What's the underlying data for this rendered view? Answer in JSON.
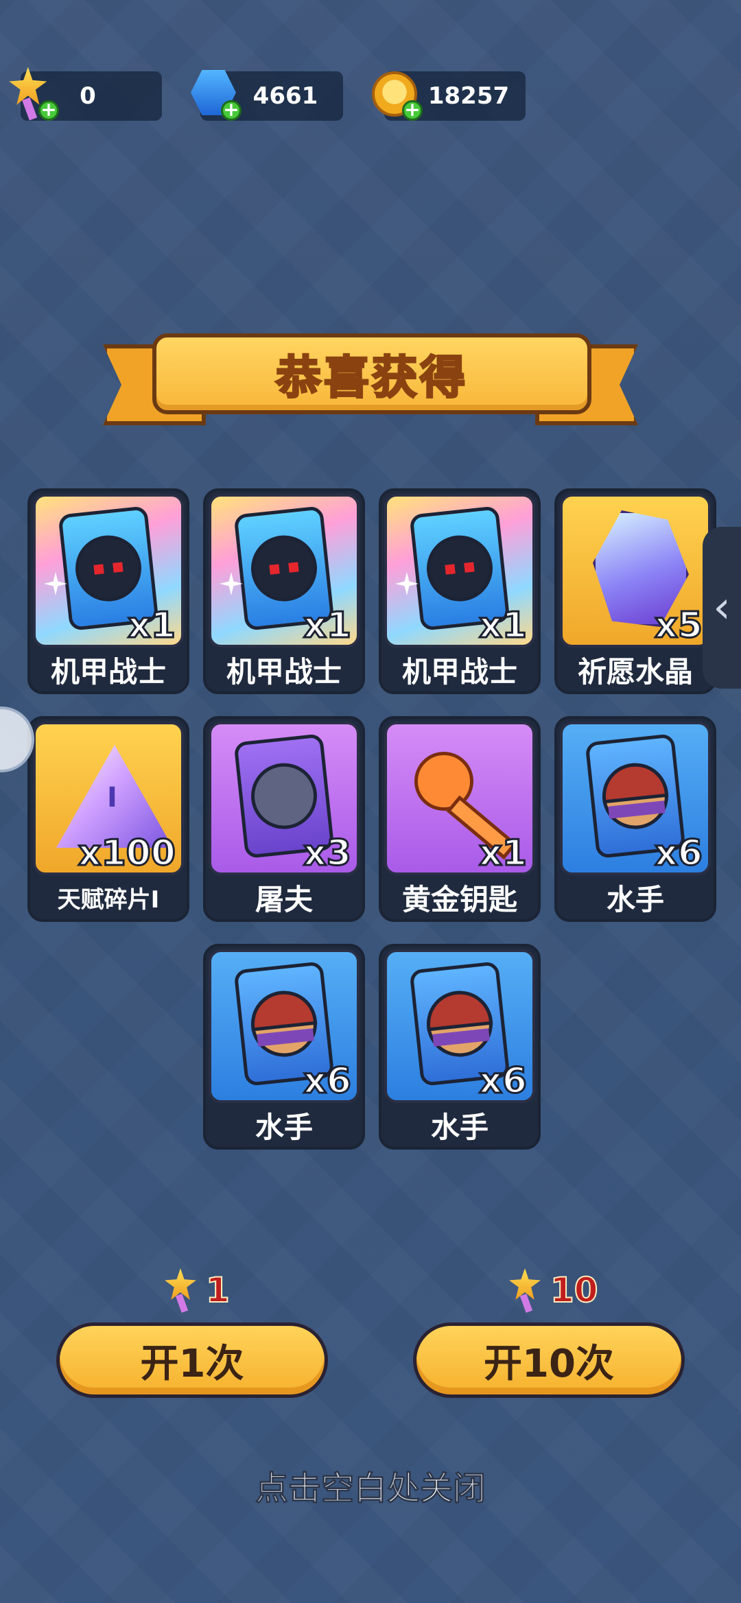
{
  "currencies": [
    {
      "icon": "star-wand-icon",
      "value": "0"
    },
    {
      "icon": "blue-gem-icon",
      "value": "4661"
    },
    {
      "icon": "gold-coin-icon",
      "value": "18257"
    }
  ],
  "banner": {
    "title": "恭喜获得"
  },
  "rewards": [
    {
      "name": "机甲战士",
      "count": "x1",
      "icon": "mech-warrior-card-icon"
    },
    {
      "name": "机甲战士",
      "count": "x1",
      "icon": "mech-warrior-card-icon"
    },
    {
      "name": "机甲战士",
      "count": "x1",
      "icon": "mech-warrior-card-icon"
    },
    {
      "name": "祈愿水晶",
      "count": "x5",
      "icon": "wish-crystal-icon"
    },
    {
      "name": "天赋碎片Ⅰ",
      "count": "x100",
      "icon": "talent-shard-icon"
    },
    {
      "name": "屠夫",
      "count": "x3",
      "icon": "butcher-card-icon"
    },
    {
      "name": "黄金钥匙",
      "count": "x1",
      "icon": "golden-key-icon"
    },
    {
      "name": "水手",
      "count": "x6",
      "icon": "sailor-card-icon"
    },
    {
      "name": "水手",
      "count": "x6",
      "icon": "sailor-card-icon"
    },
    {
      "name": "水手",
      "count": "x6",
      "icon": "sailor-card-icon"
    }
  ],
  "actions": {
    "open_once": {
      "cost": "1",
      "label": "开1次"
    },
    "open_ten": {
      "cost": "10",
      "label": "开10次"
    }
  },
  "close_hint": "点击空白处关闭"
}
